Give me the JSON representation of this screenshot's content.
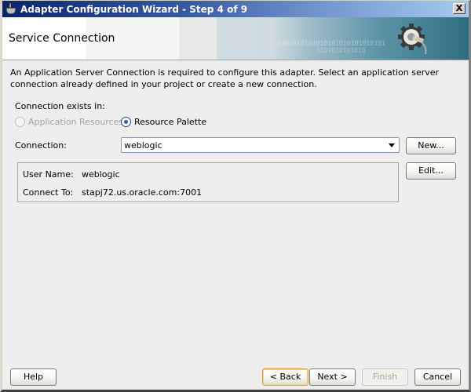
{
  "window": {
    "title": "Adapter Configuration Wizard - Step 4 of 9",
    "close_label": "X"
  },
  "header": {
    "title": "Service Connection",
    "banner_binary_1": "0101010101010101010101010101",
    "banner_binary_2": "0101010101010"
  },
  "content": {
    "description": "An Application Server Connection is required to configure this adapter. Select an application server connection already defined in your project or create a new connection.",
    "connection_exists_label": "Connection exists in:",
    "radio_options": [
      {
        "label": "Application Resources",
        "selected": false,
        "enabled": false
      },
      {
        "label": "Resource Palette",
        "selected": true,
        "enabled": true
      }
    ],
    "connection_label": "Connection:",
    "connection_value": "weblogic",
    "new_button": "New...",
    "edit_button": "Edit...",
    "details": {
      "user_name_label": "User Name:",
      "user_name_value": "weblogic",
      "connect_to_label": "Connect To:",
      "connect_to_value": "stapj72.us.oracle.com:7001"
    }
  },
  "footer": {
    "help": "Help",
    "back": "< Back",
    "next": "Next >",
    "finish": "Finish",
    "cancel": "Cancel"
  }
}
